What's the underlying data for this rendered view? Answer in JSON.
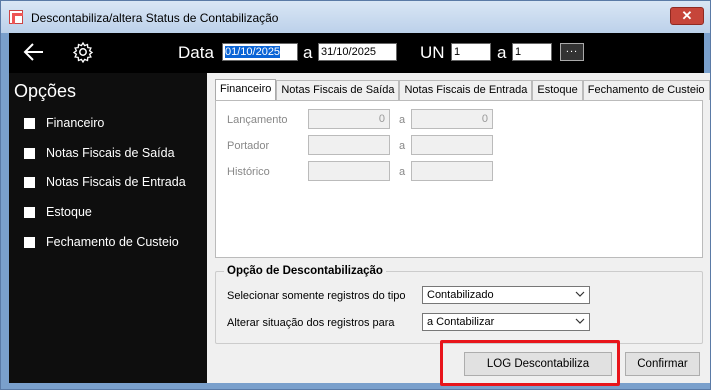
{
  "window": {
    "title": "Descontabiliza/altera Status de Contabilização",
    "close_label": "✕"
  },
  "topbar": {
    "data_label": "Data",
    "date_from": "01/10/2025",
    "a_label_1": "a",
    "date_to": "31/10/2025",
    "un_label": "UN",
    "un_from": "1",
    "a_label_2": "a",
    "un_to": "1",
    "more_label": "..."
  },
  "sidebar": {
    "title": "Opções",
    "items": [
      {
        "label": "Financeiro"
      },
      {
        "label": "Notas Fiscais de Saída"
      },
      {
        "label": "Notas Fiscais de Entrada"
      },
      {
        "label": "Estoque"
      },
      {
        "label": "Fechamento de Custeio"
      }
    ]
  },
  "tabs": [
    {
      "label": "Financeiro"
    },
    {
      "label": "Notas Fiscais de Saída"
    },
    {
      "label": "Notas Fiscais de Entrada"
    },
    {
      "label": "Estoque"
    },
    {
      "label": "Fechamento de Custeio"
    }
  ],
  "financeiro": {
    "rows": [
      {
        "label": "Lançamento",
        "from": "0",
        "a": "a",
        "to": "0"
      },
      {
        "label": "Portador",
        "from": "",
        "a": "a",
        "to": ""
      },
      {
        "label": "Histórico",
        "from": "",
        "a": "a",
        "to": ""
      }
    ]
  },
  "descontabilizacao": {
    "title": "Opção de Descontabilização",
    "tipo_label": "Selecionar somente registros do tipo",
    "tipo_value": "Contabilizado",
    "situacao_label": "Alterar situação dos registros para",
    "situacao_value": "a Contabilizar"
  },
  "buttons": {
    "log_label": "LOG Descontabiliza",
    "confirmar_label": "Confirmar"
  },
  "colors": {
    "highlight": "#e8151b",
    "selection": "#0a64d6"
  }
}
